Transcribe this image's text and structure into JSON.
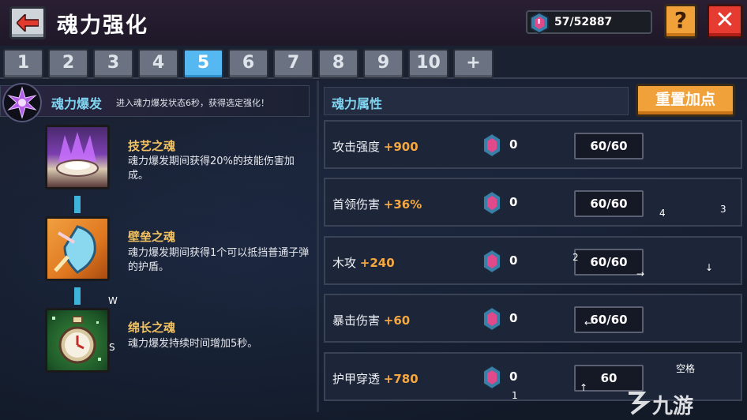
{
  "header": {
    "title": "魂力强化",
    "currency_count": "57/52887",
    "help_label": "?",
    "close_label": "✕"
  },
  "tabs": [
    "1",
    "2",
    "3",
    "4",
    "5",
    "6",
    "7",
    "8",
    "9",
    "10",
    "+"
  ],
  "active_tab": "5",
  "burst": {
    "title": "魂力爆发",
    "description": "进入魂力爆发状态6秒，获得选定强化！"
  },
  "skills": [
    {
      "name": "技艺之魂",
      "description": "魂力爆发期间获得20%的技能伤害加成。"
    },
    {
      "name": "壁垒之魂",
      "description": "魂力爆发期间获得1个可以抵挡普通子弹的护盾。"
    },
    {
      "name": "绵长之魂",
      "description": "魂力爆发持续时间增加5秒。"
    }
  ],
  "attributes": {
    "header": "魂力属性",
    "reset_label": "重置加点",
    "rows": [
      {
        "label": "攻击强度",
        "bonus": "+900",
        "cost": "0",
        "level": "60/60"
      },
      {
        "label": "首领伤害",
        "bonus": "+36%",
        "cost": "0",
        "level": "60/60"
      },
      {
        "label": "木攻",
        "bonus": "+240",
        "cost": "0",
        "level": "60/60"
      },
      {
        "label": "暴击伤害",
        "bonus": "+60",
        "cost": "0",
        "level": "60/60"
      },
      {
        "label": "护甲穿透",
        "bonus": "+780",
        "cost": "0",
        "level": "60"
      }
    ]
  },
  "key_hints": {
    "w": "W",
    "s": "S",
    "k4": "4",
    "k3": "3",
    "k2": "2",
    "k1": "1",
    "right_arrow": "→",
    "down_arrow": "↓",
    "left_arrow": "←",
    "up_arrow": "↑",
    "space": "空格"
  },
  "watermark": "九游",
  "colors": {
    "accent_blue": "#55b8f0",
    "accent_orange": "#f0a13a",
    "close_red": "#e63b30",
    "bonus_orange": "#f5a742",
    "skill_name_gold": "#f2c260",
    "section_title_cyan": "#7fd4f0"
  }
}
